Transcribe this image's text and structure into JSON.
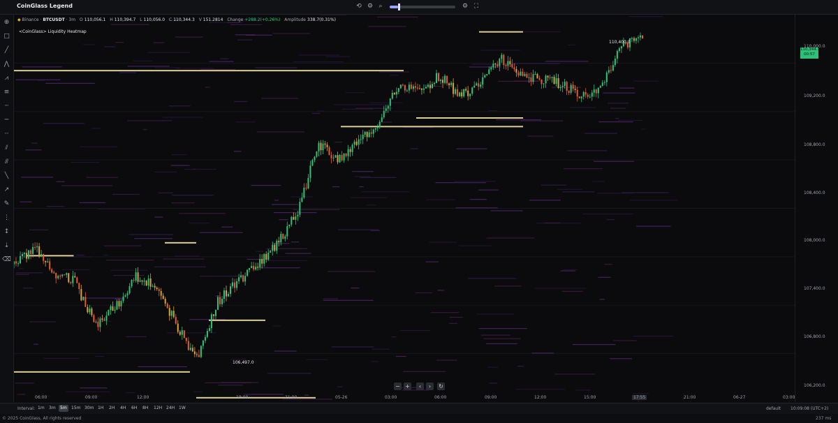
{
  "app": {
    "title": "CoinGlass Legend"
  },
  "toolbar_icons": [
    "replay-icon",
    "settings-icon",
    "search-icon",
    "fullscreen-icon"
  ],
  "symbol": {
    "exchange": "Binance",
    "pair": "BTCUSDT",
    "interval": "3m",
    "open_label": "O",
    "open": "110,056.1",
    "high_label": "H",
    "high": "110,394.7",
    "low_label": "L",
    "low": "110,056.0",
    "close_label": "C",
    "close": "110,344.3",
    "volume_label": "V",
    "volume": "151.2814",
    "change_label": "Change",
    "change": "+288.2(+0.26%)",
    "amplitude_label": "Amplitude",
    "amplitude": "338.7(0.31%)"
  },
  "indicator": {
    "title": "<CoinGlass> Liquidity Heatmap"
  },
  "price_axis": {
    "ticks": [
      "110,000.0",
      "109,200.0",
      "108,800.0",
      "108,400.0",
      "108,000.0",
      "107,400.0",
      "106,800.0",
      "106,200.0"
    ],
    "current_price": "110,344.3",
    "countdown": "00:57"
  },
  "time_axis": {
    "ticks": [
      "06:00",
      "09:00",
      "12:00",
      "18:00",
      "21:00",
      "05-26",
      "03:00",
      "06:00",
      "09:00",
      "12:00",
      "15:00",
      "17:55",
      "21:00",
      "06-27",
      "03:00"
    ]
  },
  "annotations": {
    "low_price": "106,497.0",
    "high_price": "110,400.0"
  },
  "nav_buttons": [
    "−",
    "+",
    "‹",
    "›",
    "↻"
  ],
  "bottom_bar": {
    "interval_label": "Interval:",
    "intervals": [
      "1m",
      "3m",
      "5m",
      "15m",
      "30m",
      "1H",
      "2H",
      "4H",
      "6H",
      "8H",
      "12H",
      "24H",
      "1W"
    ],
    "active_interval": "5m",
    "default_label": "default",
    "timezone": "10:09:08 (UTC+2)"
  },
  "footer": {
    "copyright": "© 2025 CoinGlass, All rights reserved",
    "latency": "237 ms"
  },
  "colors": {
    "up": "#2fc47a",
    "down": "#e35d2f",
    "background": "#0b0b0d",
    "level": "#f3e3a8",
    "accent": "#9aa4ff"
  },
  "chart_data": {
    "type": "candlestick-heatmap",
    "y_axis_range": [
      106100,
      110600
    ],
    "price_path": [
      107700,
      107900,
      107600,
      107500,
      107000,
      107200,
      107550,
      107450,
      107000,
      106600,
      107250,
      107500,
      107700,
      107950,
      108300,
      109100,
      108900,
      109150,
      109350,
      109800,
      109700,
      109900,
      109650,
      109800,
      110100,
      109900,
      109850,
      109800,
      109650,
      109750,
      110250,
      110344
    ],
    "liquidity_levels": [
      {
        "price": 109950,
        "from": 0.0,
        "to": 0.62
      },
      {
        "price": 109300,
        "from": 0.52,
        "to": 0.81
      },
      {
        "price": 109400,
        "from": 0.64,
        "to": 0.81
      },
      {
        "price": 110400,
        "from": 0.74,
        "to": 0.81
      },
      {
        "price": 107800,
        "from": 0.02,
        "to": 0.095
      },
      {
        "price": 107950,
        "from": 0.24,
        "to": 0.29
      },
      {
        "price": 107050,
        "from": 0.31,
        "to": 0.4
      },
      {
        "price": 106450,
        "from": 0.0,
        "to": 0.28
      },
      {
        "price": 106150,
        "from": 0.29,
        "to": 0.48
      }
    ]
  }
}
